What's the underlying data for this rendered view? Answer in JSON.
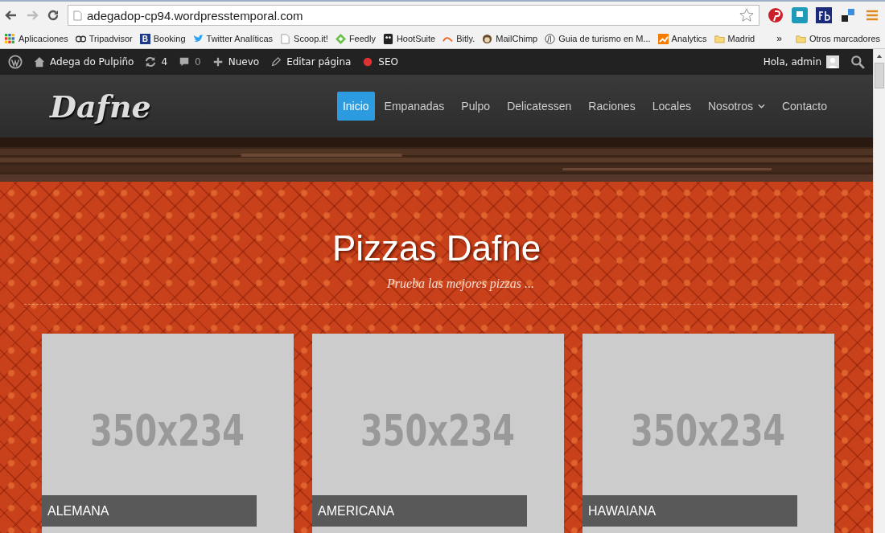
{
  "browser": {
    "url": "adegadop-cp94.wordpresstemporal.com",
    "bookmarks": [
      {
        "label": "Aplicaciones",
        "kind": "apps"
      },
      {
        "label": "Tripadvisor",
        "kind": "owl"
      },
      {
        "label": "Booking",
        "kind": "letter",
        "glyph": "B"
      },
      {
        "label": "Twitter Analíticas",
        "kind": "bird"
      },
      {
        "label": "Scoop.it!",
        "kind": "page"
      },
      {
        "label": "Feedly",
        "kind": "leaf"
      },
      {
        "label": "HootSuite",
        "kind": "owl2"
      },
      {
        "label": "Bitly.",
        "kind": "bitly"
      },
      {
        "label": "MailChimp",
        "kind": "chimp"
      },
      {
        "label": "Guia de turismo en M...",
        "kind": "circle"
      },
      {
        "label": "Analytics",
        "kind": "chart"
      },
      {
        "label": "Madrid",
        "kind": "folder"
      }
    ],
    "overflow": "»",
    "other_bookmarks": "Otros marcadores"
  },
  "admin_bar": {
    "site": "Adega do Pulpiño",
    "updates": "4",
    "comments": "0",
    "new": "Nuevo",
    "edit": "Editar página",
    "seo": "SEO",
    "greeting": "Hola, admin"
  },
  "header": {
    "logo": "Dafne",
    "nav": [
      {
        "label": "Inicio",
        "selected": true
      },
      {
        "label": "Empanadas",
        "selected": false
      },
      {
        "label": "Pulpo",
        "selected": false
      },
      {
        "label": "Delicatessen",
        "selected": false
      },
      {
        "label": "Raciones",
        "selected": false
      },
      {
        "label": "Locales",
        "selected": false
      },
      {
        "label": "Nosotros",
        "selected": false,
        "dropdown": true
      },
      {
        "label": "Contacto",
        "selected": false
      }
    ]
  },
  "hero": {
    "title": "Pizzas Dafne",
    "subtitle": "Prueba las mejores pizzas ..."
  },
  "cards": [
    {
      "placeholder": "350x234",
      "label": "ALEMANA"
    },
    {
      "placeholder": "350x234",
      "label": "AMERICANA"
    },
    {
      "placeholder": "350x234",
      "label": "HAWAIANA"
    }
  ]
}
